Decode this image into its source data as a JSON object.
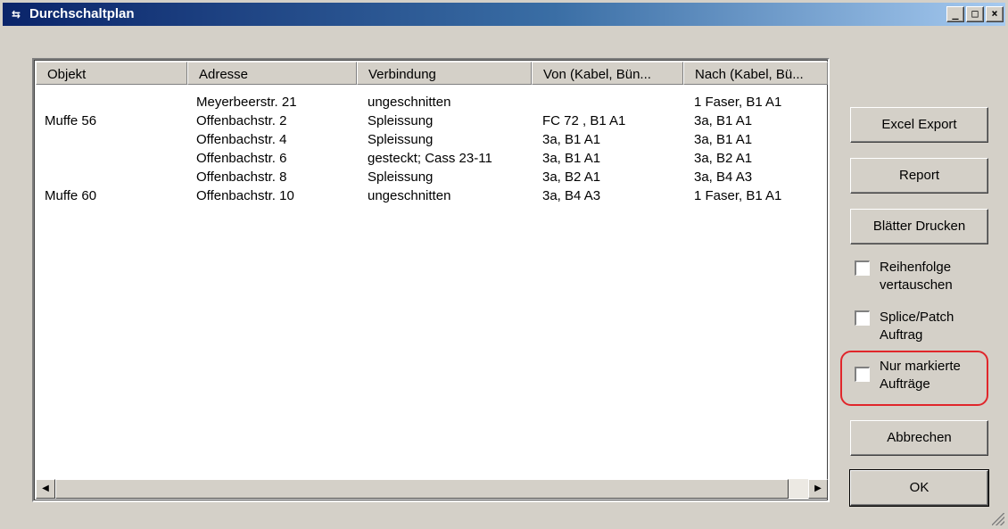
{
  "window": {
    "title": "Durchschaltplan",
    "app_icon": "fiber-path-icon",
    "controls": {
      "minimize": "_",
      "maximize": "□",
      "close": "×"
    }
  },
  "list": {
    "columns": [
      "Objekt",
      "Adresse",
      "Verbindung",
      "Von (Kabel, Bün...",
      "Nach (Kabel, Bü..."
    ],
    "rows": [
      [
        "",
        "Meyerbeerstr. 21",
        "ungeschnitten",
        "",
        "1 Faser, B1 A1"
      ],
      [
        "Muffe 56",
        "Offenbachstr. 2",
        "Spleissung",
        "FC 72 , B1 A1",
        "3a, B1 A1"
      ],
      [
        "",
        "Offenbachstr. 4",
        "Spleissung",
        "3a, B1 A1",
        "3a, B1 A1"
      ],
      [
        "",
        "Offenbachstr. 6",
        "gesteckt; Cass 23-11",
        "3a, B1 A1",
        "3a, B2 A1"
      ],
      [
        "",
        "Offenbachstr. 8",
        "Spleissung",
        "3a, B2 A1",
        "3a, B4 A3"
      ],
      [
        "Muffe 60",
        "Offenbachstr. 10",
        "ungeschnitten",
        "3a, B4 A3",
        "1 Faser, B1 A1"
      ]
    ]
  },
  "buttons": {
    "excel_export": "Excel Export",
    "report": "Report",
    "print_sheets": "Blätter Drucken",
    "cancel": "Abbrechen",
    "ok": "OK"
  },
  "checkboxes": {
    "swap_order": {
      "label": "Reihenfolge vertauschen",
      "checked": false
    },
    "splice_patch": {
      "label": "Splice/Patch Auftrag",
      "checked": false
    },
    "only_marked": {
      "label": "Nur markierte Aufträge",
      "checked": false
    }
  },
  "colors": {
    "titlebar_start": "#0a246a",
    "titlebar_end": "#a6caf0",
    "dialog_bg": "#d4d0c8",
    "highlight": "#e0262b"
  }
}
